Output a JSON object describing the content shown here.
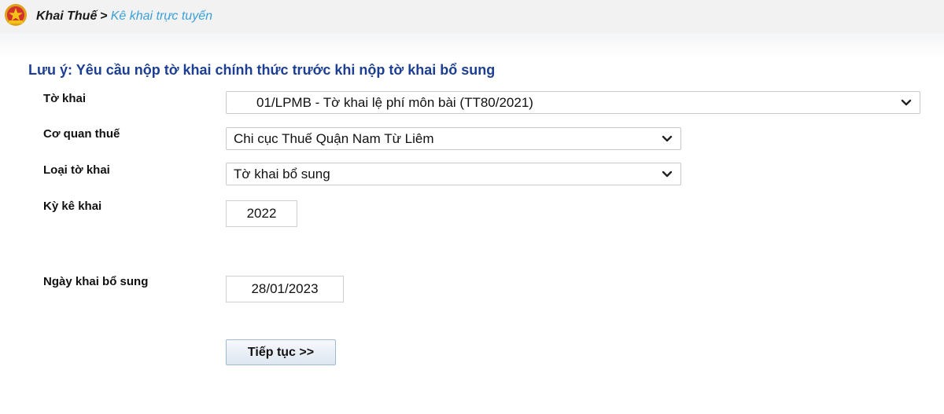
{
  "breadcrumb": {
    "root": "Khai Thuế",
    "separator": ">",
    "current": "Kê khai trực tuyến"
  },
  "notice": "Lưu ý: Yêu cầu nộp tờ khai chính thức trước khi nộp tờ khai bổ sung",
  "form": {
    "to_khai": {
      "label": "Tờ khai",
      "value": "01/LPMB - Tờ khai lệ phí môn bài (TT80/2021)"
    },
    "co_quan_thue": {
      "label": "Cơ quan thuế",
      "value": "Chi cục Thuế Quận Nam Từ Liêm"
    },
    "loai_to_khai": {
      "label": "Loại tờ khai",
      "value": "Tờ khai bổ sung"
    },
    "ky_ke_khai": {
      "label": "Kỳ kê khai",
      "value": "2022"
    },
    "ngay_khai_bo_sung": {
      "label": "Ngày khai bổ sung",
      "value": "28/01/2023"
    }
  },
  "continue_button": "Tiếp tục >>",
  "colors": {
    "notice": "#1c3f93",
    "breadcrumb_link": "#3aa0d8",
    "emblem_red": "#d2332a",
    "emblem_gold": "#f2c21b"
  },
  "icons": {
    "emblem": "national-emblem-icon",
    "dropdown": "chevron-down-icon"
  }
}
